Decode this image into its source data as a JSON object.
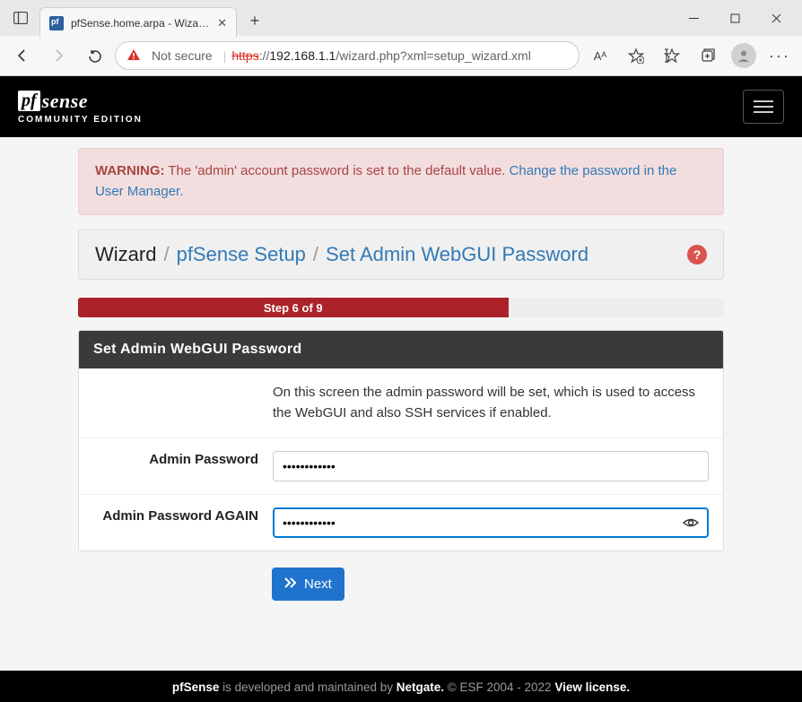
{
  "browser": {
    "tab_title": "pfSense.home.arpa - Wizard: pfS",
    "not_secure_label": "Not secure",
    "url_protocol": "https",
    "url_host": "192.168.1.1",
    "url_path": "/wizard.php?xml=setup_wizard.xml",
    "reader_label": "Aᴬ"
  },
  "brand": {
    "pf": "pf",
    "sense": "sense",
    "edition": "COMMUNITY EDITION"
  },
  "alert": {
    "warning_label": "WARNING:",
    "text": " The 'admin' account password is set to the default value. ",
    "link_text": "Change the password in the User Manager."
  },
  "breadcrumb": {
    "root": "Wizard",
    "mid": "pfSense Setup",
    "leaf": "Set Admin WebGUI Password"
  },
  "progress": {
    "label": "Step 6 of 9",
    "current": 6,
    "total": 9
  },
  "panel": {
    "heading": "Set Admin WebGUI Password",
    "description": "On this screen the admin password will be set, which is used to access the WebGUI and also SSH services if enabled.",
    "fields": [
      {
        "label": "Admin Password",
        "value": "••••••••••••"
      },
      {
        "label": "Admin Password AGAIN",
        "value": "••••••••••••"
      }
    ],
    "next_label": "Next"
  },
  "footer": {
    "product": "pfSense",
    "mid": " is developed and maintained by ",
    "company": "Netgate.",
    "copyright": " © ESF 2004 - 2022 ",
    "license": "View license."
  }
}
